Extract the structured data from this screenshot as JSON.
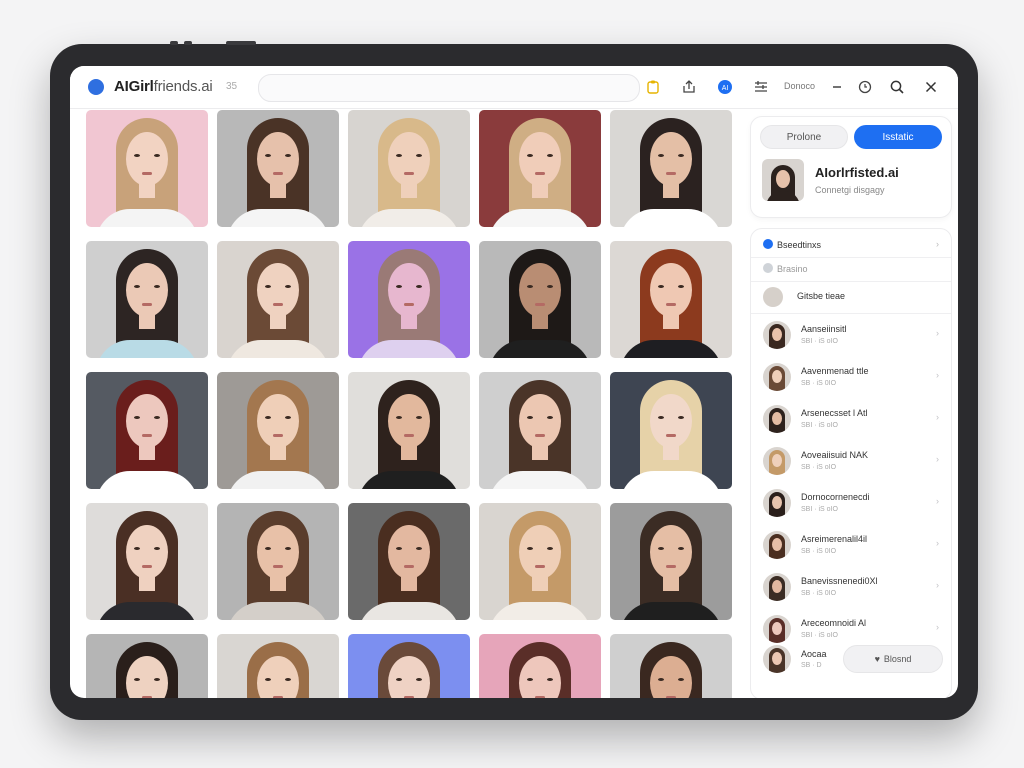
{
  "app": {
    "title_main": "AIGirl",
    "title_sub": "friends.ai",
    "badge": "35"
  },
  "toolbar": {
    "icons": [
      "clipboard-icon",
      "share-icon",
      "ai-badge-icon",
      "list-icon",
      "minimize-icon",
      "clock-icon",
      "search-icon",
      "close-icon"
    ],
    "text": "Donoco",
    "ai_badge": "AI"
  },
  "grid": {
    "rows": 5,
    "cols": 5,
    "tiles": [
      {
        "bg": "#f1c6d2",
        "hair": "#c8a27a",
        "skin": "#f2d3c2",
        "top": "#f4f4f4"
      },
      {
        "bg": "#b8b8b8",
        "hair": "#4a3326",
        "skin": "#e6c1ab",
        "top": "#f5f5f5"
      },
      {
        "bg": "#d7d4d0",
        "hair": "#d8b98a",
        "skin": "#efd0bb",
        "top": "#f1ede8"
      },
      {
        "bg": "#8a3b3c",
        "hair": "#cfae84",
        "skin": "#f0cdb9",
        "top": "#f6f6f6"
      },
      {
        "bg": "#d9d7d4",
        "hair": "#2b2220",
        "skin": "#e4bfa6",
        "top": "#ffffff"
      },
      {
        "bg": "#cfcfcf",
        "hair": "#2d2523",
        "skin": "#ebc9b6",
        "top": "#b9dbe6"
      },
      {
        "bg": "#d9d4cf",
        "hair": "#6b4a36",
        "skin": "#efd2c0",
        "top": "#efe8e0"
      },
      {
        "bg": "#9a72e6",
        "hair": "#9a7a76",
        "skin": "#e7b7cf",
        "top": "#ded0ef"
      },
      {
        "bg": "#b9b9b9",
        "hair": "#1e1917",
        "skin": "#b98d73",
        "top": "#1f1f1f"
      },
      {
        "bg": "#dcd8d4",
        "hair": "#8c3a1e",
        "skin": "#efc8b3",
        "top": "#1e1e22"
      },
      {
        "bg": "#555a62",
        "hair": "#6a1e1c",
        "skin": "#edc8be",
        "top": "#ffffff"
      },
      {
        "bg": "#9e9a96",
        "hair": "#a3774f",
        "skin": "#efcfb8",
        "top": "#f1f1f1"
      },
      {
        "bg": "#e0dedb",
        "hair": "#2e221d",
        "skin": "#e2b89d",
        "top": "#1f1f1f"
      },
      {
        "bg": "#cfcfcf",
        "hair": "#4a3428",
        "skin": "#ecc7b2",
        "top": "#f5f5f5"
      },
      {
        "bg": "#3e4552",
        "hair": "#e6d2a8",
        "skin": "#f1d8c9",
        "top": "#ffffff"
      },
      {
        "bg": "#dedcda",
        "hair": "#4a2f24",
        "skin": "#efd1c0",
        "top": "#2a2a2e"
      },
      {
        "bg": "#b4b4b4",
        "hair": "#5a3d2c",
        "skin": "#e8c1a8",
        "top": "#d4cfc9"
      },
      {
        "bg": "#6a6a6a",
        "hair": "#4a2e20",
        "skin": "#e3b8a0",
        "top": "#e9e6e2"
      },
      {
        "bg": "#d9d5d0",
        "hair": "#c49a68",
        "skin": "#efcfb7",
        "top": "#f2ede7"
      },
      {
        "bg": "#9c9c9c",
        "hair": "#3b2c24",
        "skin": "#e5bea5",
        "top": "#1f1f1f"
      },
      {
        "bg": "#b5b5b5",
        "hair": "#2a1f1b",
        "skin": "#eed2c1",
        "top": "#f5f5f5"
      },
      {
        "bg": "#d9d6d2",
        "hair": "#9a6e48",
        "skin": "#efd0bb",
        "top": "#efebe6"
      },
      {
        "bg": "#7c8ff0",
        "hair": "#6a4a3a",
        "skin": "#efd2c4",
        "top": "#e8eaf7"
      },
      {
        "bg": "#e6a5ba",
        "hair": "#5a2e28",
        "skin": "#eec7bc",
        "top": "#f1dfe4"
      },
      {
        "bg": "#cfcfcf",
        "hair": "#3a2820",
        "skin": "#dcae92",
        "top": "#eeeeee"
      }
    ]
  },
  "panel": {
    "tabs": {
      "left": "Prolone",
      "right": "Isstatic"
    },
    "profile": {
      "name": "AIorlrfisted.ai",
      "subtitle": "Connetgi disgagy"
    },
    "sections": [
      {
        "label": "Bseedtinxs",
        "icon": "blue-dot-icon"
      },
      {
        "label": "Brasino",
        "icon": "grey-dot-icon"
      }
    ],
    "list_header": "Gitsbe tieae",
    "list": [
      {
        "name": "Aanseiinsitl",
        "meta": "SBI · iS oIO",
        "hair": "#3a2820",
        "skin": "#e9c2ab"
      },
      {
        "name": "Aavenmenad ttle",
        "meta": "SB · iS 0IO",
        "hair": "#6a4a36",
        "skin": "#efcfb9"
      },
      {
        "name": "Arsenecsset l Atl",
        "meta": "SBI · iS oIO",
        "hair": "#2e221d",
        "skin": "#e4bca3"
      },
      {
        "name": "Aoveaiisuid NAK",
        "meta": "SB · iS oIO",
        "hair": "#c49a68",
        "skin": "#efd0bb"
      },
      {
        "name": "Dornocornenecdi",
        "meta": "SBI · iS oIO",
        "hair": "#2a1f1b",
        "skin": "#e7c4ae"
      },
      {
        "name": "Asreimerenalil4il",
        "meta": "SB · iS 0IO",
        "hair": "#4a2e20",
        "skin": "#e6bea7"
      },
      {
        "name": "Banevissnenedi0Xl",
        "meta": "SB · iS 0IO",
        "hair": "#3b2c24",
        "skin": "#e3b8a0"
      },
      {
        "name": "Areceomnoidi Al",
        "meta": "SBI · iS oIO",
        "hair": "#5a2e28",
        "skin": "#eec7bc"
      }
    ],
    "footer": {
      "name": "Aocaa",
      "meta": "SB · D",
      "button": "Blosnd",
      "button_icon": "heart-icon"
    }
  }
}
